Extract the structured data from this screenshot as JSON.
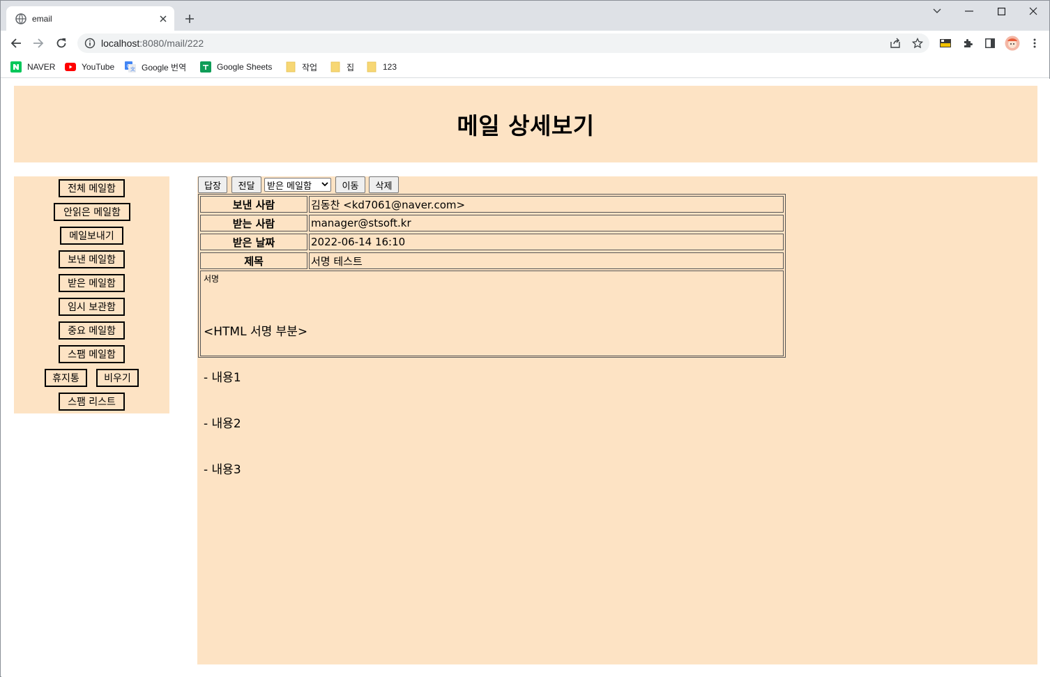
{
  "browser": {
    "tab_title": "email",
    "url_host": "localhost",
    "url_path": ":8080/mail/222",
    "bookmarks": [
      {
        "label": "NAVER",
        "icon": "naver-icon",
        "color": "#03c75a"
      },
      {
        "label": "YouTube",
        "icon": "youtube-icon",
        "color": "#ff0000"
      },
      {
        "label": "Google 번역",
        "icon": "google-translate-icon",
        "color": "#4285f4"
      },
      {
        "label": "Google Sheets",
        "icon": "google-sheets-icon",
        "color": "#0f9d58"
      },
      {
        "label": "작업",
        "icon": "folder-icon",
        "color": "#f7d774"
      },
      {
        "label": "집",
        "icon": "folder-icon",
        "color": "#f7d774"
      },
      {
        "label": "123",
        "icon": "folder-icon",
        "color": "#f7d774"
      }
    ]
  },
  "page": {
    "title": "메일 상세보기",
    "accent_color": "#fde3c4"
  },
  "sidebar": {
    "items": [
      {
        "label": "전체 메일함"
      },
      {
        "label": "안읽은 메일함"
      },
      {
        "label": "메일보내기"
      },
      {
        "label": "보낸 메일함"
      },
      {
        "label": "받은 메일함"
      },
      {
        "label": "임시 보관함"
      },
      {
        "label": "중요 메일함"
      },
      {
        "label": "스팸 메일함"
      },
      {
        "label": "휴지통"
      },
      {
        "label": "비우기"
      },
      {
        "label": "스팸 리스트"
      }
    ]
  },
  "actions": {
    "reply": "답장",
    "forward": "전달",
    "folder_select": "받은 메일함",
    "move": "이동",
    "delete": "삭제"
  },
  "mail": {
    "from_label": "보낸 사람",
    "from_value": "김동찬 <kd7061@naver.com>",
    "to_label": "받는 사람",
    "to_value": "manager@stsoft.kr",
    "date_label": "받은 날짜",
    "date_value": "2022-06-14 16:10",
    "subject_label": "제목",
    "subject_value": "서명 테스트",
    "body_label": "서명",
    "body_lines": [
      "<HTML 서명 부분>",
      "- 내용1",
      "- 내용2",
      "- 내용3"
    ]
  }
}
